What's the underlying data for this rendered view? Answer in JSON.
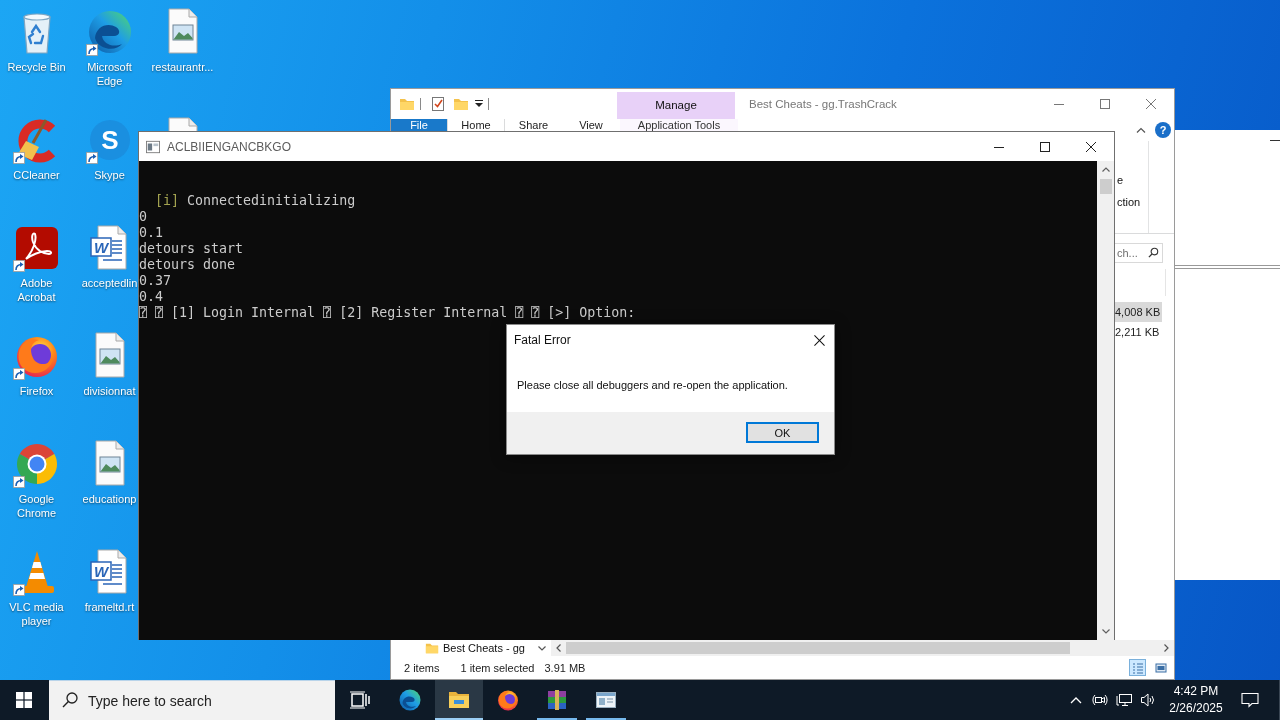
{
  "desktop": {
    "columns": [
      [
        {
          "kind": "recyclebin",
          "label": "Recycle Bin",
          "shortcut": false
        },
        {
          "kind": "ccleaner",
          "label": "CCleaner",
          "shortcut": true
        },
        {
          "kind": "acrobat",
          "label": "Adobe Acrobat",
          "shortcut": true
        },
        {
          "kind": "firefox",
          "label": "Firefox",
          "shortcut": true
        },
        {
          "kind": "chrome",
          "label": "Google Chrome",
          "shortcut": true
        },
        {
          "kind": "vlc",
          "label": "VLC media player",
          "shortcut": true
        }
      ],
      [
        {
          "kind": "edge",
          "label": "Microsoft Edge",
          "shortcut": true
        },
        {
          "kind": "skype",
          "label": "Skype",
          "shortcut": true,
          "logo_text": "S"
        },
        {
          "kind": "word",
          "label": "acceptedlin",
          "shortcut": false,
          "logo_text": "W"
        },
        {
          "kind": "image",
          "label": "divisionnat",
          "shortcut": false
        },
        {
          "kind": "image",
          "label": "educationp",
          "shortcut": false
        },
        {
          "kind": "word",
          "label": "frameltd.rt",
          "shortcut": false,
          "logo_text": "W"
        }
      ],
      [
        {
          "kind": "image",
          "label": "restaurantr...",
          "shortcut": false
        },
        {
          "kind": "image",
          "shortcut": false
        }
      ]
    ]
  },
  "explorer": {
    "context_tab": "Manage",
    "title": "Best Cheats - gg.TrashCrack",
    "tabs": [
      {
        "label": "File",
        "kind": "file",
        "selected": false
      },
      {
        "label": "Home",
        "kind": "tab",
        "selected": true
      },
      {
        "label": "Share",
        "kind": "tab",
        "selected": false
      },
      {
        "label": "View",
        "kind": "tab",
        "selected": false
      },
      {
        "label": "Application Tools",
        "kind": "contextual",
        "selected": false
      }
    ],
    "help": "?",
    "ribbon_fragments": [
      "e",
      "ction"
    ],
    "search": {
      "placeholder": "ch..."
    },
    "files": [
      {
        "size": "4,008 KB",
        "selected": true
      },
      {
        "size": "2,211 KB",
        "selected": false
      }
    ],
    "nav_item": "Best Cheats - gg",
    "status": {
      "count": "2 items",
      "selection": "1 item selected",
      "size": "3.91 MB"
    },
    "views": [
      {
        "selected": true
      },
      {
        "selected": false
      }
    ]
  },
  "console": {
    "title": "ACLBIIENGANCBKGO",
    "lines": [
      {
        "kind": "info",
        "tag": "[i]",
        "text": "Connectedinitializing"
      },
      {
        "kind": "plain",
        "text": "0"
      },
      {
        "kind": "plain",
        "text": "0.1"
      },
      {
        "kind": "plain",
        "text": "detours start"
      },
      {
        "kind": "plain",
        "text": "detours done"
      },
      {
        "kind": "plain",
        "text": "0.37"
      },
      {
        "kind": "plain",
        "text": "0.4"
      },
      {
        "kind": "plain",
        "text": "⍰ ⍰ [1] Login Internal ⍰ [2] Register Internal ⍰ ⍰ [>] Option:"
      }
    ]
  },
  "dialog": {
    "title": "Fatal Error",
    "message": "Please close all debuggers and re-open the application.",
    "button": {
      "label": "OK",
      "focused": true
    }
  },
  "taskbar": {
    "search": {
      "placeholder": "Type here to search"
    },
    "apps": [
      {
        "kind": "edge",
        "running": false,
        "active": false
      },
      {
        "kind": "explorer",
        "running": true,
        "active": true
      },
      {
        "kind": "firefox",
        "running": false,
        "active": false
      },
      {
        "kind": "winrar",
        "running": true,
        "active": false
      },
      {
        "kind": "window",
        "running": true,
        "active": false
      }
    ],
    "time": "4:42 PM",
    "date": "2/26/2025"
  }
}
